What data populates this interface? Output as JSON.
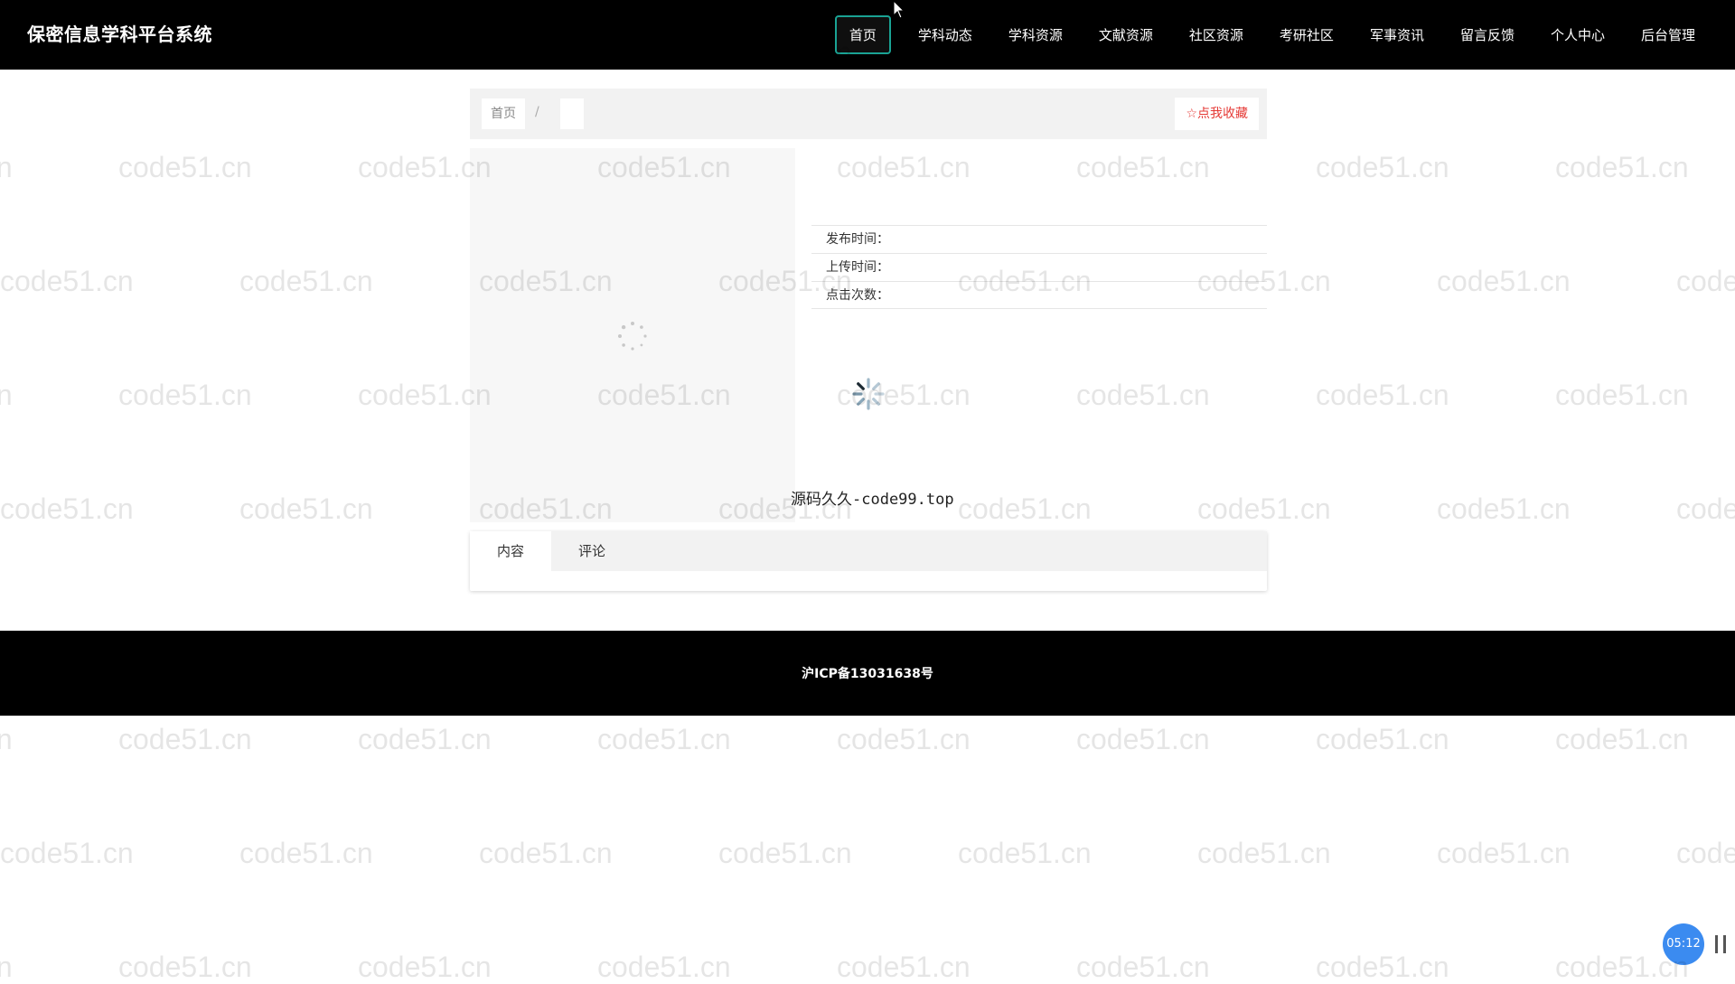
{
  "app": {
    "brand": "保密信息学科平台系统"
  },
  "nav": {
    "items": [
      {
        "label": "首页",
        "active": true
      },
      {
        "label": "学科动态"
      },
      {
        "label": "学科资源"
      },
      {
        "label": "文献资源"
      },
      {
        "label": "社区资源"
      },
      {
        "label": "考研社区"
      },
      {
        "label": "军事资讯"
      },
      {
        "label": "留言反馈"
      },
      {
        "label": "个人中心"
      },
      {
        "label": "后台管理"
      }
    ]
  },
  "breadcrumb": {
    "home": "首页",
    "separator": "/",
    "current": ""
  },
  "favorite": {
    "label": "☆点我收藏"
  },
  "info": {
    "publish_time_label": "发布时间：",
    "upload_time_label": "上传时间：",
    "clicks_label": "点击次数："
  },
  "overlay_brand": "源码久久-code99.top",
  "tabs": [
    {
      "label": "内容",
      "active": true
    },
    {
      "label": "评论"
    }
  ],
  "footer": {
    "icp": "沪ICP备13031638号"
  },
  "player": {
    "time": "05:12"
  },
  "watermark": {
    "text": "code51.cn"
  },
  "colors": {
    "header_bg": "#000000",
    "accent": "#1aa394",
    "favorite": "#e53935",
    "timer_bg": "#3b8bf0"
  }
}
